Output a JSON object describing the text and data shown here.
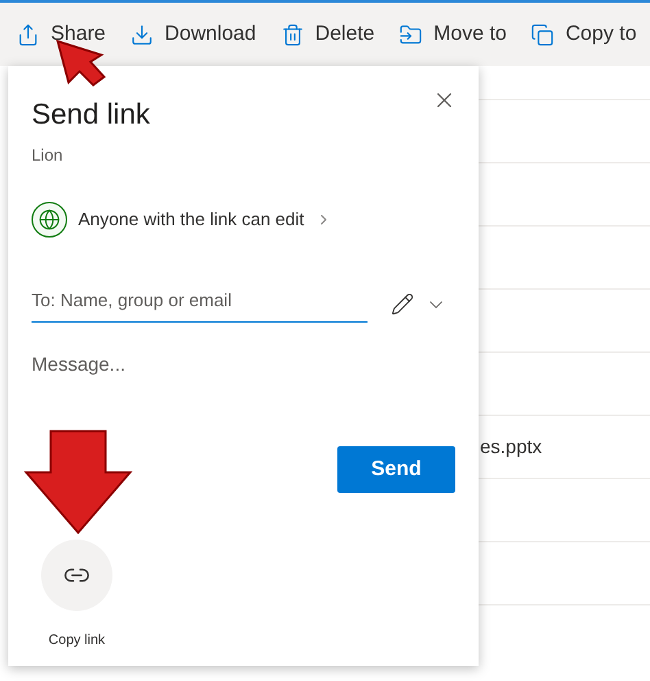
{
  "toolbar": [
    {
      "kind": "share",
      "label": "Share"
    },
    {
      "kind": "download",
      "label": "Download"
    },
    {
      "kind": "delete",
      "label": "Delete"
    },
    {
      "kind": "move",
      "label": "Move to"
    },
    {
      "kind": "copy",
      "label": "Copy to"
    }
  ],
  "dialog": {
    "title": "Send link",
    "subtitle": "Lion",
    "permission": "Anyone with the link can edit",
    "recipient": {
      "placeholder": "To: Name, group or email"
    },
    "message": {
      "placeholder": "Message..."
    },
    "send_button": "Send",
    "copy_link": "Copy link"
  },
  "file_rows": [
    "",
    "",
    "",
    "",
    "",
    "es.pptx",
    "",
    "",
    ""
  ]
}
